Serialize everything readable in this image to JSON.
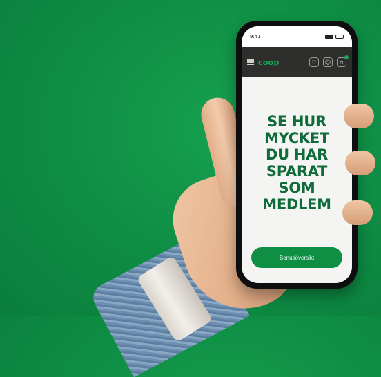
{
  "status_bar": {
    "time": "9:41"
  },
  "app_header": {
    "logo_text": "coop",
    "icons": [
      "menu-icon",
      "heart-icon",
      "user-icon",
      "cart-icon"
    ],
    "accent_color": "#19a556"
  },
  "hero": {
    "headline_lines": [
      "SE HUR",
      "MYCKET",
      "DU HAR",
      "SPARAT",
      "SOM",
      "MEDLEM"
    ],
    "headline_color": "#0f6b3a"
  },
  "cta": {
    "label": "Bonusöversikt",
    "color": "#0f8f44"
  },
  "background_color": "#0f9046"
}
